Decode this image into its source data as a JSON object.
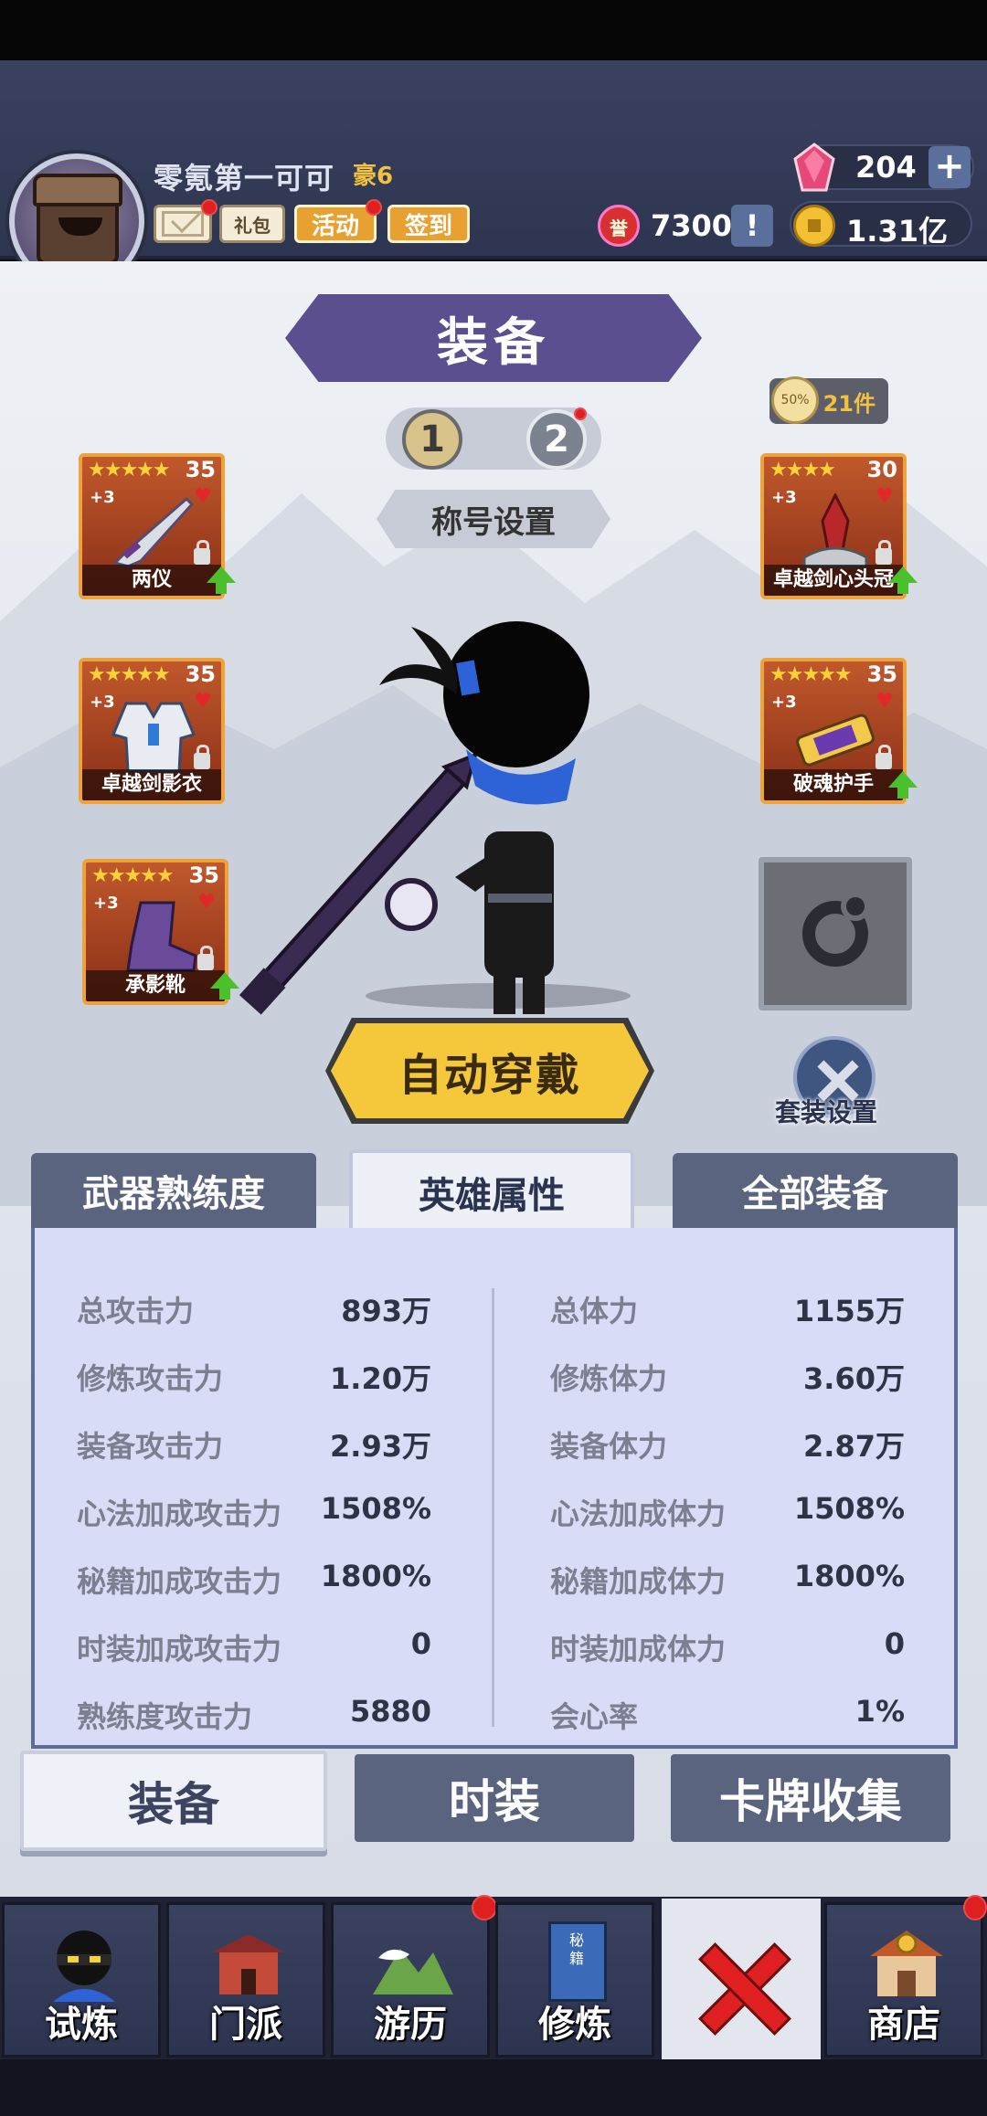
{
  "header": {
    "player_name": "零氪第一可可",
    "vip_label": "豪6",
    "extra_button": "礼包",
    "event_button": "活动",
    "signin_button": "签到",
    "gems": "204",
    "gem_plus": "+",
    "honor_icon": "誉",
    "honor": "7300",
    "honor_info": "!",
    "gold": "1.31亿"
  },
  "screen": {
    "title": "装备",
    "page_1": "1",
    "page_2": "2",
    "title_setting": "称号设置",
    "pieces_icon_text": "50%",
    "pieces_count": "21件",
    "auto_wear": "自动穿戴",
    "suit_setting": "套装设置"
  },
  "slots": [
    {
      "name": "两仪",
      "stars": "★★★★★",
      "level": "35",
      "plus": "+3",
      "upgrade": true,
      "icon": "sword-icon"
    },
    {
      "name": "卓越剑心头冠",
      "stars": "★★★★",
      "level": "30",
      "plus": "+3",
      "upgrade": true,
      "icon": "helmet-icon"
    },
    {
      "name": "卓越剑影衣",
      "stars": "★★★★★",
      "level": "35",
      "plus": "+3",
      "upgrade": false,
      "icon": "armor-icon"
    },
    {
      "name": "破魂护手",
      "stars": "★★★★★",
      "level": "35",
      "plus": "+3",
      "upgrade": true,
      "icon": "gauntlet-icon"
    },
    {
      "name": "承影靴",
      "stars": "★★★★★",
      "level": "35",
      "plus": "+3",
      "upgrade": true,
      "icon": "boot-icon"
    }
  ],
  "tabs": {
    "weapon": "武器熟练度",
    "hero": "英雄属性",
    "all": "全部装备"
  },
  "stats_left": [
    {
      "label": "总攻击力",
      "value": "893万"
    },
    {
      "label": "修炼攻击力",
      "value": "1.20万"
    },
    {
      "label": "装备攻击力",
      "value": "2.93万"
    },
    {
      "label": "心法加成攻击力",
      "value": "1508%"
    },
    {
      "label": "秘籍加成攻击力",
      "value": "1800%"
    },
    {
      "label": "时装加成攻击力",
      "value": "0"
    },
    {
      "label": "熟练度攻击力",
      "value": "5880"
    }
  ],
  "stats_right": [
    {
      "label": "总体力",
      "value": "1155万"
    },
    {
      "label": "修炼体力",
      "value": "3.60万"
    },
    {
      "label": "装备体力",
      "value": "2.87万"
    },
    {
      "label": "心法加成体力",
      "value": "1508%"
    },
    {
      "label": "秘籍加成体力",
      "value": "1800%"
    },
    {
      "label": "时装加成体力",
      "value": "0"
    },
    {
      "label": "会心率",
      "value": "1%"
    }
  ],
  "categories": {
    "equip": "装备",
    "fashion": "时装",
    "cards": "卡牌收集"
  },
  "nav": [
    {
      "label": "试炼",
      "icon": "ninja-icon"
    },
    {
      "label": "门派",
      "icon": "temple-icon"
    },
    {
      "label": "游历",
      "icon": "mountain-icon"
    },
    {
      "label": "修炼",
      "icon": "book-icon",
      "book_text": "秘籍"
    },
    {
      "label": "",
      "icon": "close-icon"
    },
    {
      "label": "商店",
      "icon": "shop-icon"
    }
  ],
  "colors": {
    "accent_purple": "#5b4f8f",
    "gold_button": "#f4c83a",
    "notification_red": "#e02020",
    "slot_orange": "#c0582b"
  }
}
